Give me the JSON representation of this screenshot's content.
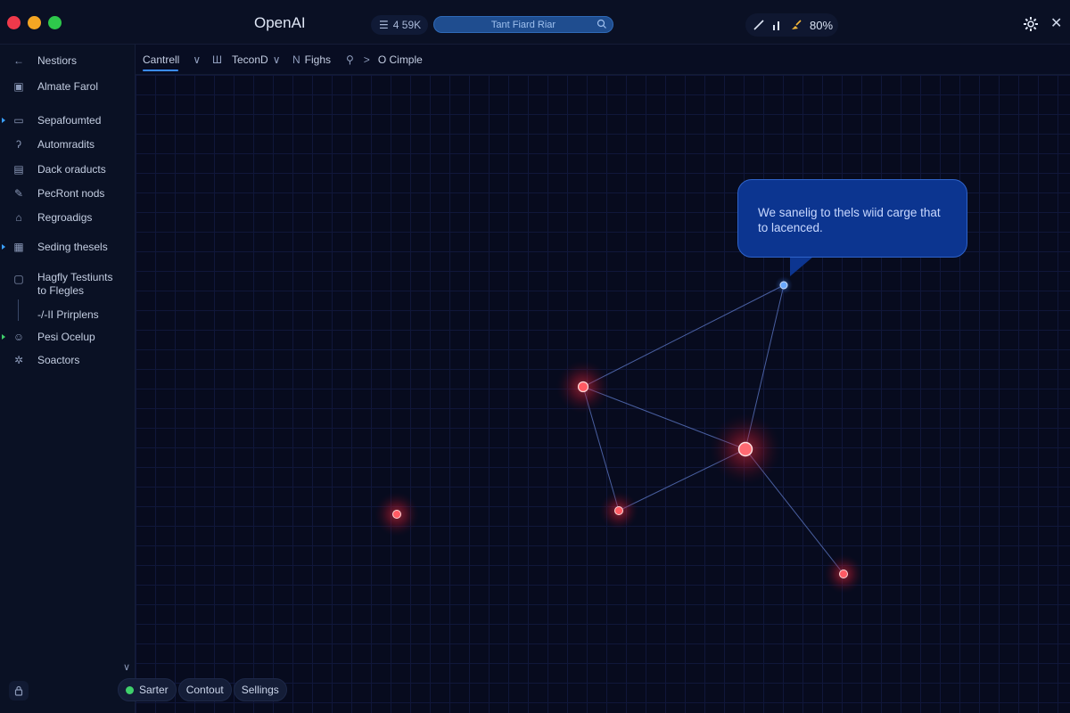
{
  "window": {
    "title": "OpenAI"
  },
  "header": {
    "counter": "4 59K",
    "search_placeholder": "Tant Fiard Riar",
    "status_value": "80%"
  },
  "toolbar": {
    "items": [
      {
        "label": "Cantrell",
        "suffix": "∨"
      },
      {
        "prefix": "Ш",
        "label": "TeconD",
        "suffix": "∨"
      },
      {
        "prefix": "N",
        "label": "Fighs"
      },
      {
        "label": "O Cimple"
      }
    ]
  },
  "sidebar": {
    "items": [
      {
        "label": "Nestiors",
        "icon": "arrow-left-icon"
      },
      {
        "label": "Almate Farol",
        "icon": "image-icon"
      },
      {
        "label": "Sepafoumted",
        "icon": "monitor-icon"
      },
      {
        "label": "Automradits",
        "icon": "pin-icon"
      },
      {
        "label": "Dack oraducts",
        "icon": "document-icon"
      },
      {
        "label": "PecRont nods",
        "icon": "pen-icon"
      },
      {
        "label": "Regroadigs",
        "icon": "house-icon"
      },
      {
        "label": "Seding thesels",
        "icon": "calendar-icon"
      },
      {
        "label": "Hagfly Testiunts",
        "label2": "to Flegles",
        "icon": "folder-icon"
      },
      {
        "label": "-/-II Prirplens"
      },
      {
        "label": "Pesi Ocelup",
        "icon": "smiley-icon"
      },
      {
        "label": "Soactors",
        "icon": "gear-icon"
      }
    ]
  },
  "canvas": {
    "bubble_text": "We sanelig to thels wiid carge that to lacenced.",
    "accent_node_color": "#4a90ff",
    "node_color": "#ff3b47"
  },
  "bottom_actions": [
    {
      "label": "Sarter"
    },
    {
      "label": "Contout"
    },
    {
      "label": "Sellings"
    }
  ]
}
